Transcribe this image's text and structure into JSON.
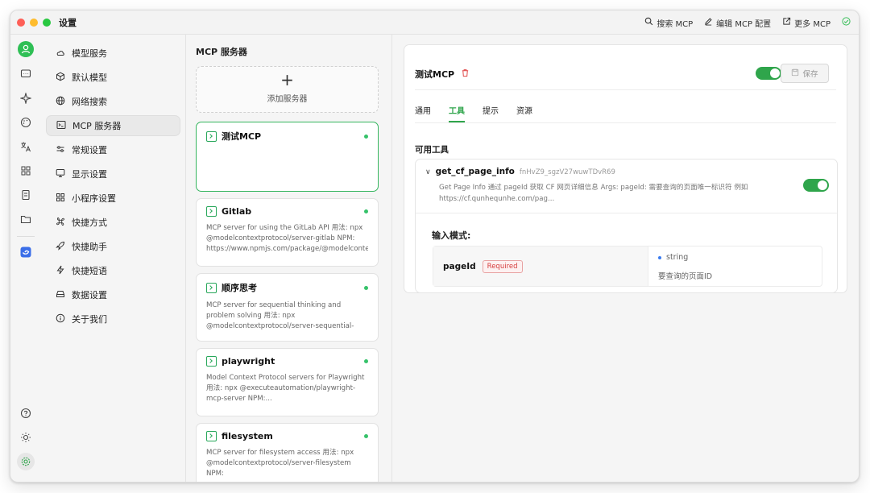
{
  "window": {
    "title": "设置"
  },
  "toolbar": {
    "search_mcp": "搜索 MCP",
    "edit_mcp_config": "编辑 MCP 配置",
    "more_mcp": "更多 MCP"
  },
  "rail": {
    "icons": [
      "chat-icon",
      "sparkle-icon",
      "palette-icon",
      "translate-icon",
      "grid-icon",
      "document-icon",
      "folder-icon",
      "app-icon"
    ],
    "bottom_icons": [
      "help-icon",
      "brightness-icon",
      "settings-icon"
    ]
  },
  "menu": {
    "items": [
      {
        "label": "模型服务",
        "icon": "cloud-icon"
      },
      {
        "label": "默认模型",
        "icon": "cube-icon"
      },
      {
        "label": "网络搜索",
        "icon": "globe-icon"
      },
      {
        "label": "MCP 服务器",
        "icon": "terminal-icon",
        "active": true
      },
      {
        "label": "常规设置",
        "icon": "sliders-icon"
      },
      {
        "label": "显示设置",
        "icon": "monitor-icon"
      },
      {
        "label": "小程序设置",
        "icon": "apps-icon"
      },
      {
        "label": "快捷方式",
        "icon": "command-icon"
      },
      {
        "label": "快捷助手",
        "icon": "rocket-icon"
      },
      {
        "label": "快捷短语",
        "icon": "zap-icon"
      },
      {
        "label": "数据设置",
        "icon": "drive-icon"
      },
      {
        "label": "关于我们",
        "icon": "info-icon"
      }
    ]
  },
  "servers": {
    "title": "MCP 服务器",
    "add_label": "添加服务器",
    "add_symbol": "+",
    "cards": [
      {
        "name": "测试MCP",
        "desc": "",
        "selected": true
      },
      {
        "name": "Gitlab",
        "desc": "MCP server for using the GitLab API 用法: npx @modelcontextprotocol/server-gitlab NPM: https://www.npmjs.com/package/@modelconte..."
      },
      {
        "name": "顺序思考",
        "desc": "MCP server for sequential thinking and problem solving 用法: npx @modelcontextprotocol/server-sequential-thinking NPM:..."
      },
      {
        "name": "playwright",
        "desc": "Model Context Protocol servers for Playwright 用法: npx @executeautomation/playwright-mcp-server NPM:..."
      },
      {
        "name": "filesystem",
        "desc": "MCP server for filesystem access 用法: npx @modelcontextprotocol/server-filesystem NPM: https://www.npmjs.com/package/@modelconte..."
      }
    ]
  },
  "detail": {
    "title": "测试MCP",
    "save_label": "保存",
    "enabled": true,
    "tabs": [
      "通用",
      "工具",
      "提示",
      "资源"
    ],
    "active_tab": "工具",
    "section_title": "可用工具",
    "tool": {
      "name": "get_cf_page_info",
      "id": "fnHvZ9_sgzV27wuwTDvR69",
      "desc": "Get Page Info 通过 pageId 获取 CF 网页详细信息 Args: pageId: 需要查询的页面唯一标识符 例如 https://cf.qunhequnhe.com/pag...",
      "enabled": true
    },
    "schema": {
      "title": "输入模式:",
      "params": [
        {
          "name": "pageId",
          "required_label": "Required",
          "type": "string",
          "desc": "要查询的页面ID"
        }
      ]
    }
  },
  "colors": {
    "accent": "#2fa54b",
    "required": "#d53c3c"
  }
}
